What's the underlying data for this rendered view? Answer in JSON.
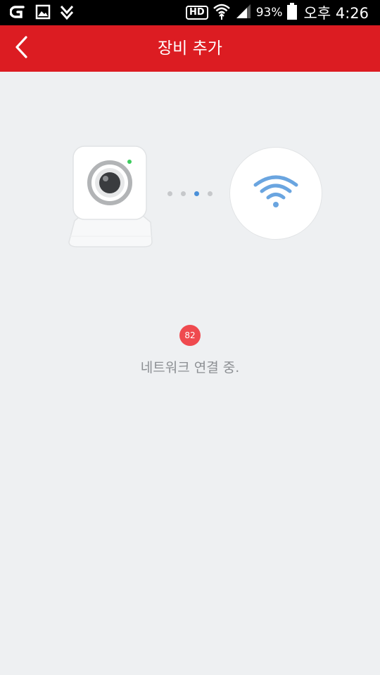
{
  "status_bar": {
    "left_icons": [
      "carrier-g-icon",
      "gallery-icon",
      "download-check-icon"
    ],
    "hd_label": "HD",
    "battery_text": "93%",
    "time": "오후 4:26"
  },
  "header": {
    "title": "장비 추가",
    "background_color": "#dc1c22"
  },
  "illustration": {
    "device_icon": "camera-icon",
    "network_icon": "wifi-icon",
    "dot_count": 4,
    "active_dot_index": 2,
    "accent_color": "#4a90d9"
  },
  "progress": {
    "value": "82",
    "status_text": "네트워크 연결 중."
  }
}
